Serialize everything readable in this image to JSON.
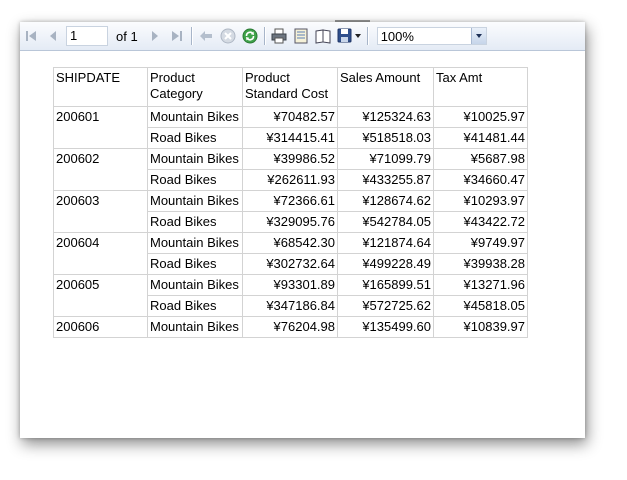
{
  "toolbar": {
    "page_value": "1",
    "of_label": "of",
    "total_pages": "1",
    "zoom_value": "100%",
    "icons": [
      "first-page-icon",
      "prev-page-icon",
      "next-page-icon",
      "last-page-icon",
      "back-icon",
      "stop-icon",
      "refresh-icon",
      "print-icon",
      "page-layout-icon",
      "page-setup-icon",
      "export-icon"
    ]
  },
  "table": {
    "headers": {
      "shipdate": "SHIPDATE",
      "category": "Product Category",
      "cost": "Product Standard Cost",
      "sales": "Sales Amount",
      "tax": "Tax Amt"
    },
    "groups": [
      {
        "shipdate": "200601",
        "rows": [
          {
            "category": "Mountain Bikes",
            "cost": "¥70482.57",
            "sales": "¥125324.63",
            "tax": "¥10025.97"
          },
          {
            "category": "Road Bikes",
            "cost": "¥314415.41",
            "sales": "¥518518.03",
            "tax": "¥41481.44"
          }
        ]
      },
      {
        "shipdate": "200602",
        "rows": [
          {
            "category": "Mountain Bikes",
            "cost": "¥39986.52",
            "sales": "¥71099.79",
            "tax": "¥5687.98"
          },
          {
            "category": "Road Bikes",
            "cost": "¥262611.93",
            "sales": "¥433255.87",
            "tax": "¥34660.47"
          }
        ]
      },
      {
        "shipdate": "200603",
        "rows": [
          {
            "category": "Mountain Bikes",
            "cost": "¥72366.61",
            "sales": "¥128674.62",
            "tax": "¥10293.97"
          },
          {
            "category": "Road Bikes",
            "cost": "¥329095.76",
            "sales": "¥542784.05",
            "tax": "¥43422.72"
          }
        ]
      },
      {
        "shipdate": "200604",
        "rows": [
          {
            "category": "Mountain Bikes",
            "cost": "¥68542.30",
            "sales": "¥121874.64",
            "tax": "¥9749.97"
          },
          {
            "category": "Road Bikes",
            "cost": "¥302732.64",
            "sales": "¥499228.49",
            "tax": "¥39938.28"
          }
        ]
      },
      {
        "shipdate": "200605",
        "rows": [
          {
            "category": "Mountain Bikes",
            "cost": "¥93301.89",
            "sales": "¥165899.51",
            "tax": "¥13271.96"
          },
          {
            "category": "Road Bikes",
            "cost": "¥347186.84",
            "sales": "¥572725.62",
            "tax": "¥45818.05"
          }
        ]
      },
      {
        "shipdate": "200606",
        "rows": [
          {
            "category": "Mountain Bikes",
            "cost": "¥76204.98",
            "sales": "¥135499.60",
            "tax": "¥10839.97"
          }
        ]
      }
    ]
  }
}
